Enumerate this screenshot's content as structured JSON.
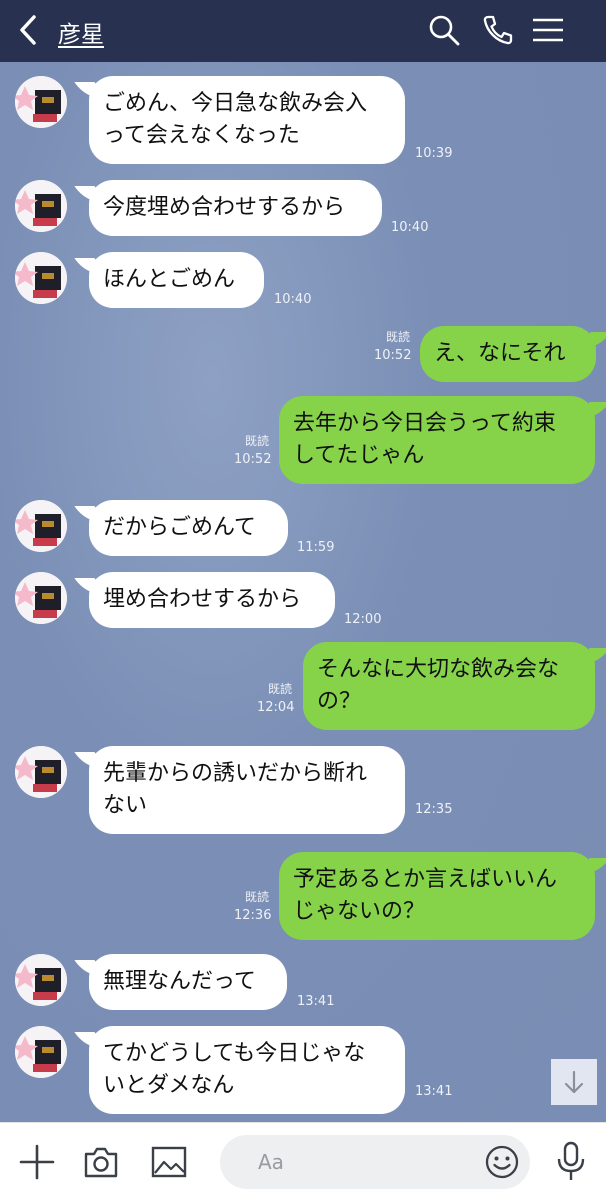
{
  "header": {
    "title": "彦星",
    "colors": {
      "background": "#283250",
      "text": "#ffffff"
    },
    "icons": [
      "back-chevron-icon",
      "search-icon",
      "phone-icon",
      "menu-icon"
    ]
  },
  "messages": [
    {
      "side": "in",
      "lines": [
        "ごめん、今日急な飲み会入",
        "って会えなくなった"
      ],
      "time": "10:39"
    },
    {
      "side": "in",
      "lines": [
        "今度埋め合わせするから"
      ],
      "time": "10:40"
    },
    {
      "side": "in",
      "lines": [
        "ほんとごめん"
      ],
      "time": "10:40"
    },
    {
      "side": "out",
      "lines": [
        "え、なにそれ"
      ],
      "time": "10:52",
      "read": "既読"
    },
    {
      "side": "out",
      "lines": [
        "去年から今日会うって約束",
        "してたじゃん"
      ],
      "time": "10:52",
      "read": "既読"
    },
    {
      "side": "in",
      "lines": [
        "だからごめんて"
      ],
      "time": "11:59"
    },
    {
      "side": "in",
      "lines": [
        "埋め合わせするから"
      ],
      "time": "12:00"
    },
    {
      "side": "out",
      "lines": [
        "そんなに大切な飲み会な",
        "の？"
      ],
      "time": "12:04",
      "read": "既読"
    },
    {
      "side": "in",
      "lines": [
        "先輩からの誘いだから断れ",
        "ない"
      ],
      "time": "12:35"
    },
    {
      "side": "out",
      "lines": [
        "予定あるとか言えばいいん",
        "じゃないの？"
      ],
      "time": "12:36",
      "read": "既読"
    },
    {
      "side": "in",
      "lines": [
        "無理なんだって"
      ],
      "time": "13:41"
    },
    {
      "side": "in",
      "lines": [
        "てかどうしても今日じゃな",
        "いとダメなん"
      ],
      "time": "13:41"
    }
  ],
  "footer": {
    "input_placeholder": "Aa",
    "icons": [
      "plus-icon",
      "camera-icon",
      "image-icon",
      "emoji-icon",
      "microphone-icon"
    ]
  },
  "colors": {
    "chat_background": "#7d91b6",
    "incoming_bubble": "#ffffff",
    "outgoing_bubble": "#86d34a"
  }
}
